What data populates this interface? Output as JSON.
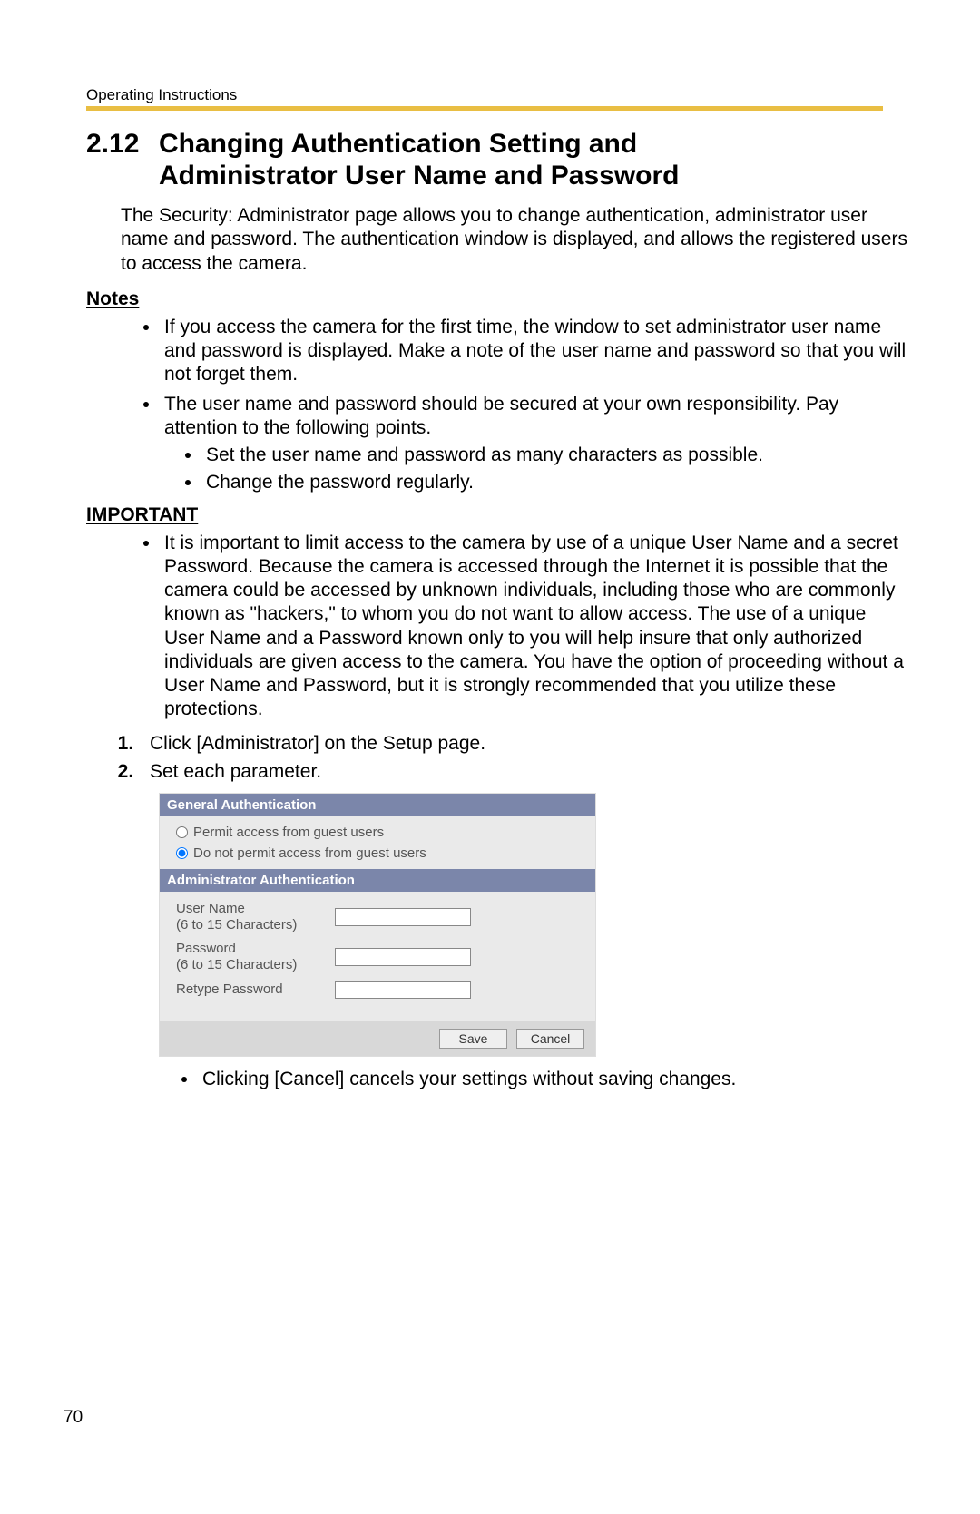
{
  "header": {
    "running": "Operating Instructions"
  },
  "section": {
    "number": "2.12",
    "title_line1": "Changing Authentication Setting and",
    "title_line2": "Administrator User Name and Password"
  },
  "intro": "The Security: Administrator page allows you to change authentication, administrator user name and password. The authentication window is displayed, and allows the registered users to access the camera.",
  "notes": {
    "heading": "Notes",
    "items": [
      "If you access the camera for the first time, the window to set administrator user name and password is displayed. Make a note of the user name and password so that you will not forget them.",
      "The user name and password should be secured at your own responsibility. Pay attention to the following points."
    ],
    "sub_items": [
      "Set the user name and password as many characters as possible.",
      "Change the password regularly."
    ]
  },
  "important": {
    "heading": "IMPORTANT",
    "text": "It is important to limit access to the camera by use of a unique User Name and a secret Password. Because the camera is accessed through the Internet it is possible that the camera could be accessed by unknown individuals, including those who are commonly known as \"hackers,\" to whom you do not want to allow access. The use of a unique User Name and a Password known only to you will help insure that only authorized individuals are given access to the camera. You have the option of proceeding without a User Name and Password, but it is strongly recommended that you utilize these protections."
  },
  "steps": {
    "s1": "Click [Administrator] on the Setup page.",
    "s2": "Set each parameter."
  },
  "form": {
    "general_header": "General Authentication",
    "radio_permit": "Permit access from guest users",
    "radio_deny": "Do not permit access from guest users",
    "admin_header": "Administrator Authentication",
    "user_label": "User Name\n(6 to 15 Characters)",
    "pass_label": "Password\n(6 to 15 Characters)",
    "retype_label": "Retype Password",
    "save": "Save",
    "cancel": "Cancel"
  },
  "footnote": "Clicking [Cancel] cancels your settings without saving changes.",
  "page_number": "70"
}
